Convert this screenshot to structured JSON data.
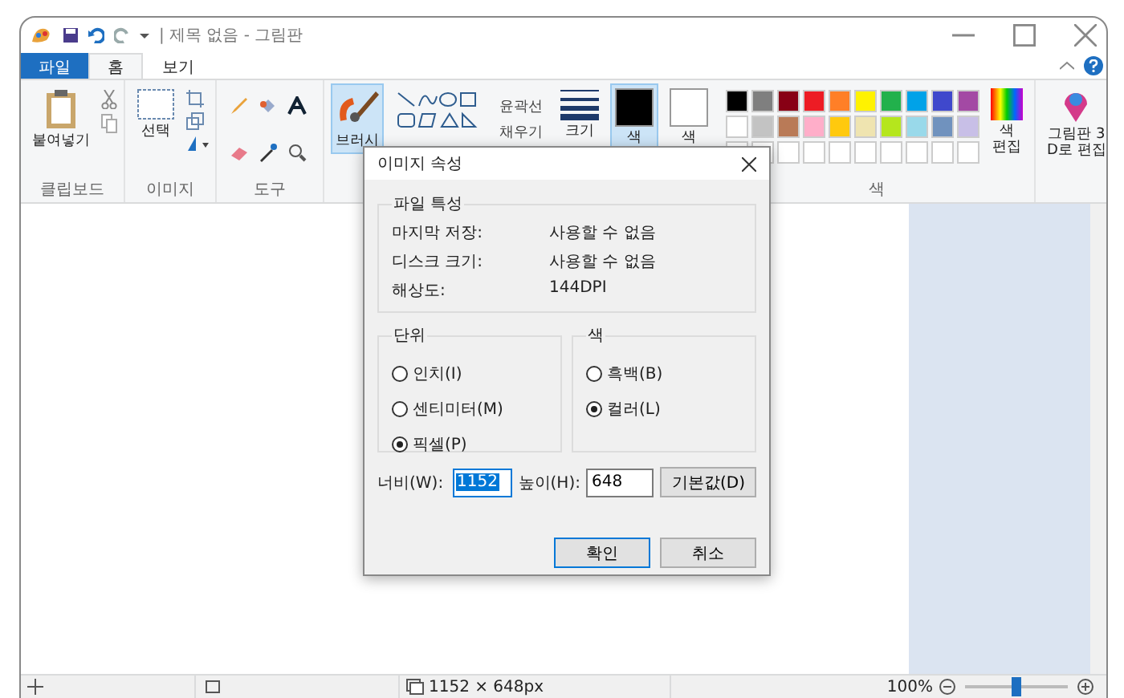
{
  "window": {
    "title": "| 제목 없음 - 그림판"
  },
  "tabs": [
    {
      "label": "파일",
      "kind": "file",
      "selected": false
    },
    {
      "label": "홈",
      "kind": "tab",
      "selected": true
    },
    {
      "label": "보기",
      "kind": "tab",
      "selected": false
    }
  ],
  "ribbon": {
    "clipboard": {
      "paste": "붙여넣기",
      "label": "클립보드"
    },
    "image": {
      "select": "선택",
      "label": "이미지"
    },
    "tools": {
      "label": "도구"
    },
    "brushes": {
      "label": "브러시",
      "selected": true
    },
    "shapes": {
      "outline": "윤곽선",
      "fill": "채우기"
    },
    "size": {
      "label": "크기"
    },
    "color1": {
      "label": "색",
      "color": "#000000",
      "selected": true
    },
    "color2": {
      "label": "색",
      "color": "#ffffff",
      "selected": false
    },
    "palette": [
      {
        "color": "#000000"
      },
      {
        "color": "#7f7f7f"
      },
      {
        "color": "#880015"
      },
      {
        "color": "#ed1c24"
      },
      {
        "color": "#ff7f27"
      },
      {
        "color": "#fff200"
      },
      {
        "color": "#22b14c"
      },
      {
        "color": "#00a2e8"
      },
      {
        "color": "#3f48cc"
      },
      {
        "color": "#a349a4"
      },
      {
        "color": "#ffffff"
      },
      {
        "color": "#c3c3c3"
      },
      {
        "color": "#b97a57"
      },
      {
        "color": "#ffaec9"
      },
      {
        "color": "#ffc90e"
      },
      {
        "color": "#efe4b0"
      },
      {
        "color": "#b5e61d"
      },
      {
        "color": "#99d9ea"
      },
      {
        "color": "#7092be"
      },
      {
        "color": "#c8bfe7"
      }
    ],
    "colors_label": "색",
    "edit_colors": [
      "색",
      "편집"
    ],
    "paint3d": [
      "그림판 3",
      "D로 편집"
    ]
  },
  "dialog": {
    "title": "이미지 속성",
    "file_properties": {
      "title": "파일 특성",
      "rows": [
        {
          "label": "마지막 저장:",
          "value": "사용할 수 없음"
        },
        {
          "label": "디스크 크기:",
          "value": "사용할 수 없음"
        },
        {
          "label": "해상도:",
          "value": "144DPI"
        }
      ]
    },
    "units": {
      "title": "단위",
      "options": [
        {
          "label": "인치(I)",
          "selected": false
        },
        {
          "label": "센티미터(M)",
          "selected": false
        },
        {
          "label": "픽셀(P)",
          "selected": true
        }
      ]
    },
    "color": {
      "title": "색",
      "options": [
        {
          "label": "흑백(B)",
          "selected": false
        },
        {
          "label": "컬러(L)",
          "selected": true
        }
      ]
    },
    "width": {
      "label": "너비(W):",
      "value": "1152"
    },
    "height": {
      "label": "높이(H):",
      "value": "648"
    },
    "default_button": "기본값(D)",
    "ok_button": "확인",
    "cancel_button": "취소"
  },
  "status_bar": {
    "size": "1152 × 648px",
    "zoom": "100%",
    "zoom_slider": {
      "level": 0.5
    }
  }
}
